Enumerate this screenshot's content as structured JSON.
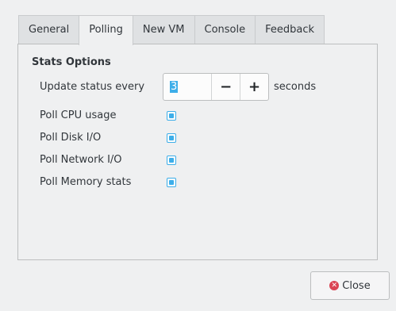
{
  "tabs": [
    {
      "label": "General",
      "active": false
    },
    {
      "label": "Polling",
      "active": true
    },
    {
      "label": "New VM",
      "active": false
    },
    {
      "label": "Console",
      "active": false
    },
    {
      "label": "Feedback",
      "active": false
    }
  ],
  "stats": {
    "title": "Stats Options",
    "update_label": "Update status every",
    "update_value": "3",
    "units": "seconds",
    "decrement_label": "−",
    "increment_label": "+",
    "options": [
      {
        "label": "Poll CPU usage",
        "checked": true
      },
      {
        "label": "Poll Disk I/O",
        "checked": true
      },
      {
        "label": "Poll Network I/O",
        "checked": true
      },
      {
        "label": "Poll Memory stats",
        "checked": true
      }
    ]
  },
  "close_button": {
    "label": "Close",
    "icon": "close-circle-icon"
  },
  "colors": {
    "accent": "#3daee9",
    "close_icon": "#da4453",
    "background": "#eff0f1"
  }
}
